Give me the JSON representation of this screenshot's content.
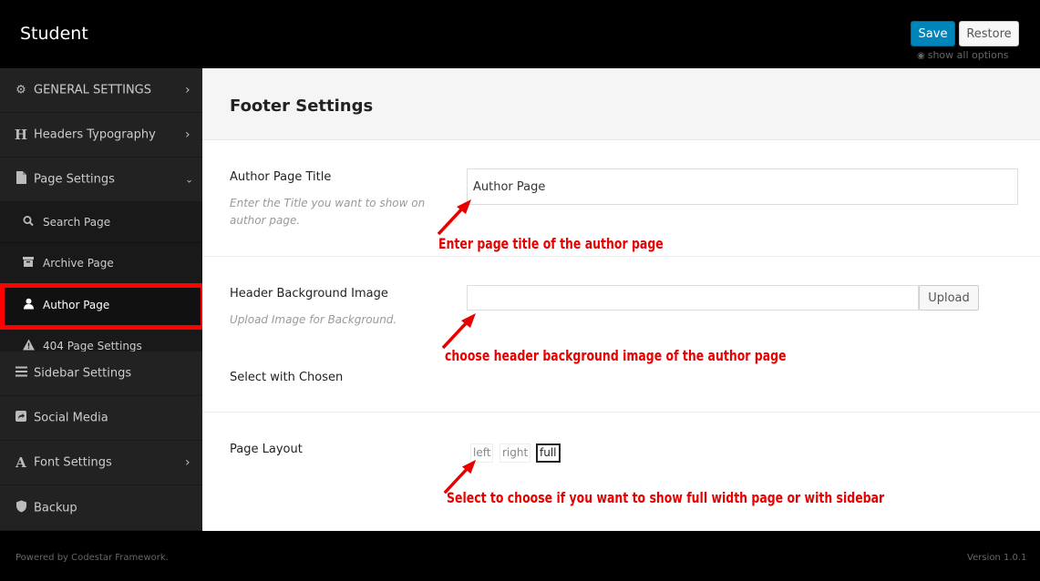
{
  "app": {
    "title": "Student",
    "save_label": "Save",
    "restore_label": "Restore",
    "show_all_label": "show all options"
  },
  "sidebar": {
    "items": [
      {
        "label": "GENERAL SETTINGS",
        "icon": "gears-icon"
      },
      {
        "label": "Headers Typography",
        "icon": "header-icon"
      },
      {
        "label": "Page Settings",
        "icon": "file-icon"
      },
      {
        "label": "Sidebar Settings",
        "icon": "bars-icon"
      },
      {
        "label": "Social Media",
        "icon": "share-square-icon"
      },
      {
        "label": "Font Settings",
        "icon": "font-icon"
      },
      {
        "label": "Backup",
        "icon": "shield-icon"
      }
    ],
    "subitems": [
      {
        "label": "Search Page",
        "icon": "search-icon"
      },
      {
        "label": "Archive Page",
        "icon": "archive-icon"
      },
      {
        "label": "Author Page",
        "icon": "user-icon"
      },
      {
        "label": "404 Page Settings",
        "icon": "warning-icon"
      }
    ],
    "highlight_color": "#ff0000"
  },
  "main": {
    "section_title": "Footer Settings",
    "fields": [
      {
        "title": "Author Page Title",
        "desc_line1": "Enter the Title you want to show on",
        "desc_line2": "author page.",
        "value": "Author Page"
      },
      {
        "title": "Header Background Image",
        "desc_line1": "Upload Image for Background.",
        "value": "",
        "button": "Upload"
      },
      {
        "title": "Select with Chosen"
      },
      {
        "title": "Page Layout",
        "options": [
          "left",
          "right",
          "full"
        ],
        "selected": "full"
      }
    ]
  },
  "annotations": {
    "color": "#e80000",
    "a1": "Enter page title of the author page",
    "a2": "choose header background image of the author page",
    "a3": "Select to choose if you want to show full width page or with sidebar"
  },
  "footer": {
    "powered": "Powered by Codestar Framework.",
    "version": "Version 1.0.1"
  }
}
